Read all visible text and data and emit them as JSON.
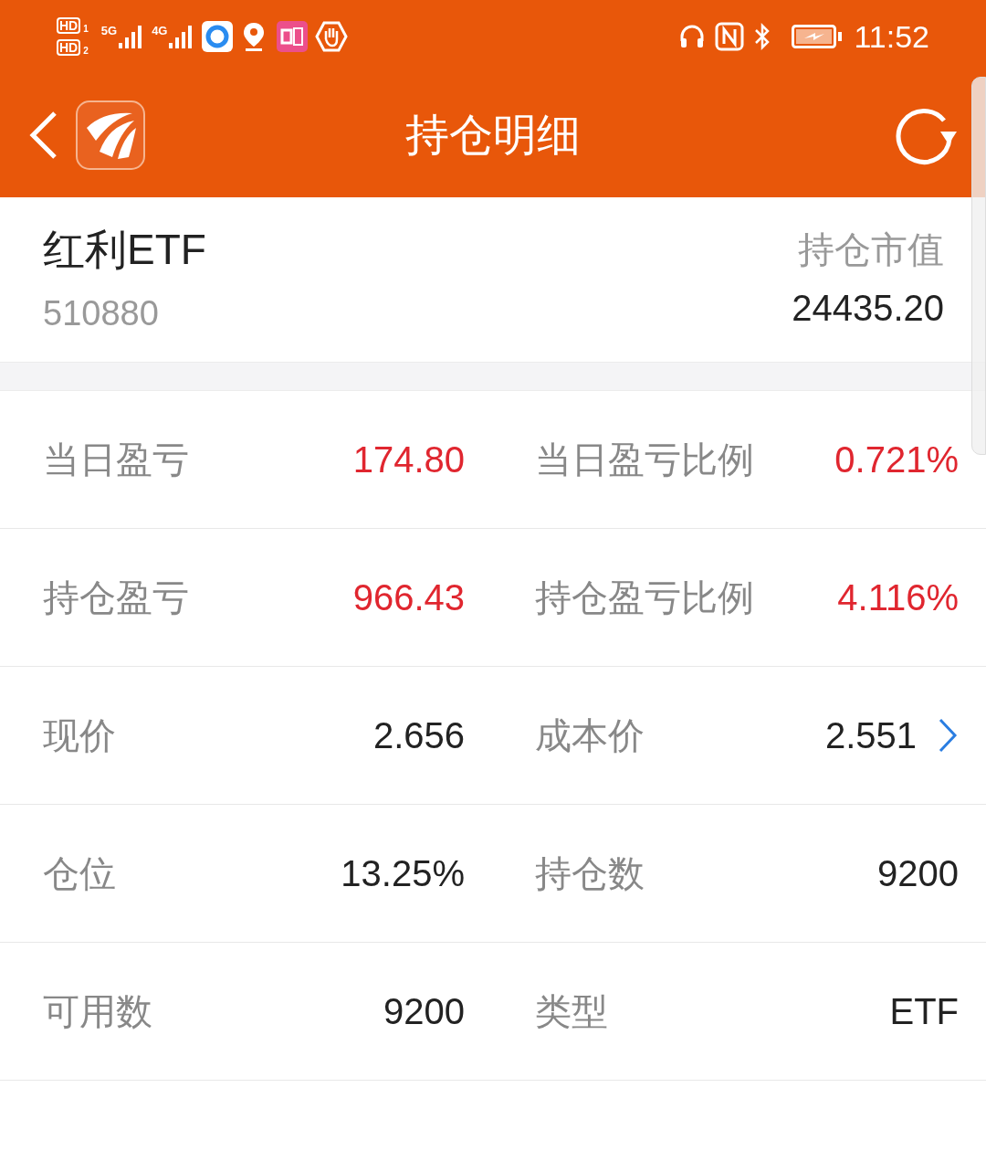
{
  "status_bar": {
    "sim_labels": [
      "HD",
      "HD"
    ],
    "sim_slots": [
      "1",
      "2"
    ],
    "networks": [
      "5G",
      "4G"
    ],
    "time": "11:52"
  },
  "header": {
    "title": "持仓明细"
  },
  "stock": {
    "name": "红利ETF",
    "code": "510880",
    "value_label": "持仓市值",
    "value": "24435.20"
  },
  "rows": [
    {
      "cells": [
        {
          "label": "当日盈亏",
          "value": "174.80",
          "color": "#e0262f"
        },
        {
          "label": "当日盈亏比例",
          "value": "0.721%",
          "color": "#e0262f"
        }
      ]
    },
    {
      "cells": [
        {
          "label": "持仓盈亏",
          "value": "966.43",
          "color": "#e0262f"
        },
        {
          "label": "持仓盈亏比例",
          "value": "4.116%",
          "color": "#e0262f"
        }
      ]
    },
    {
      "cells": [
        {
          "label": "现价",
          "value": "2.656",
          "color": "#222222"
        },
        {
          "label": "成本价",
          "value": "2.551",
          "color": "#222222",
          "link": true
        }
      ]
    },
    {
      "cells": [
        {
          "label": "仓位",
          "value": "13.25%",
          "color": "#222222"
        },
        {
          "label": "持仓数",
          "value": "9200",
          "color": "#222222"
        }
      ]
    },
    {
      "cells": [
        {
          "label": "可用数",
          "value": "9200",
          "color": "#222222"
        },
        {
          "label": "类型",
          "value": "ETF",
          "color": "#222222"
        }
      ]
    }
  ]
}
